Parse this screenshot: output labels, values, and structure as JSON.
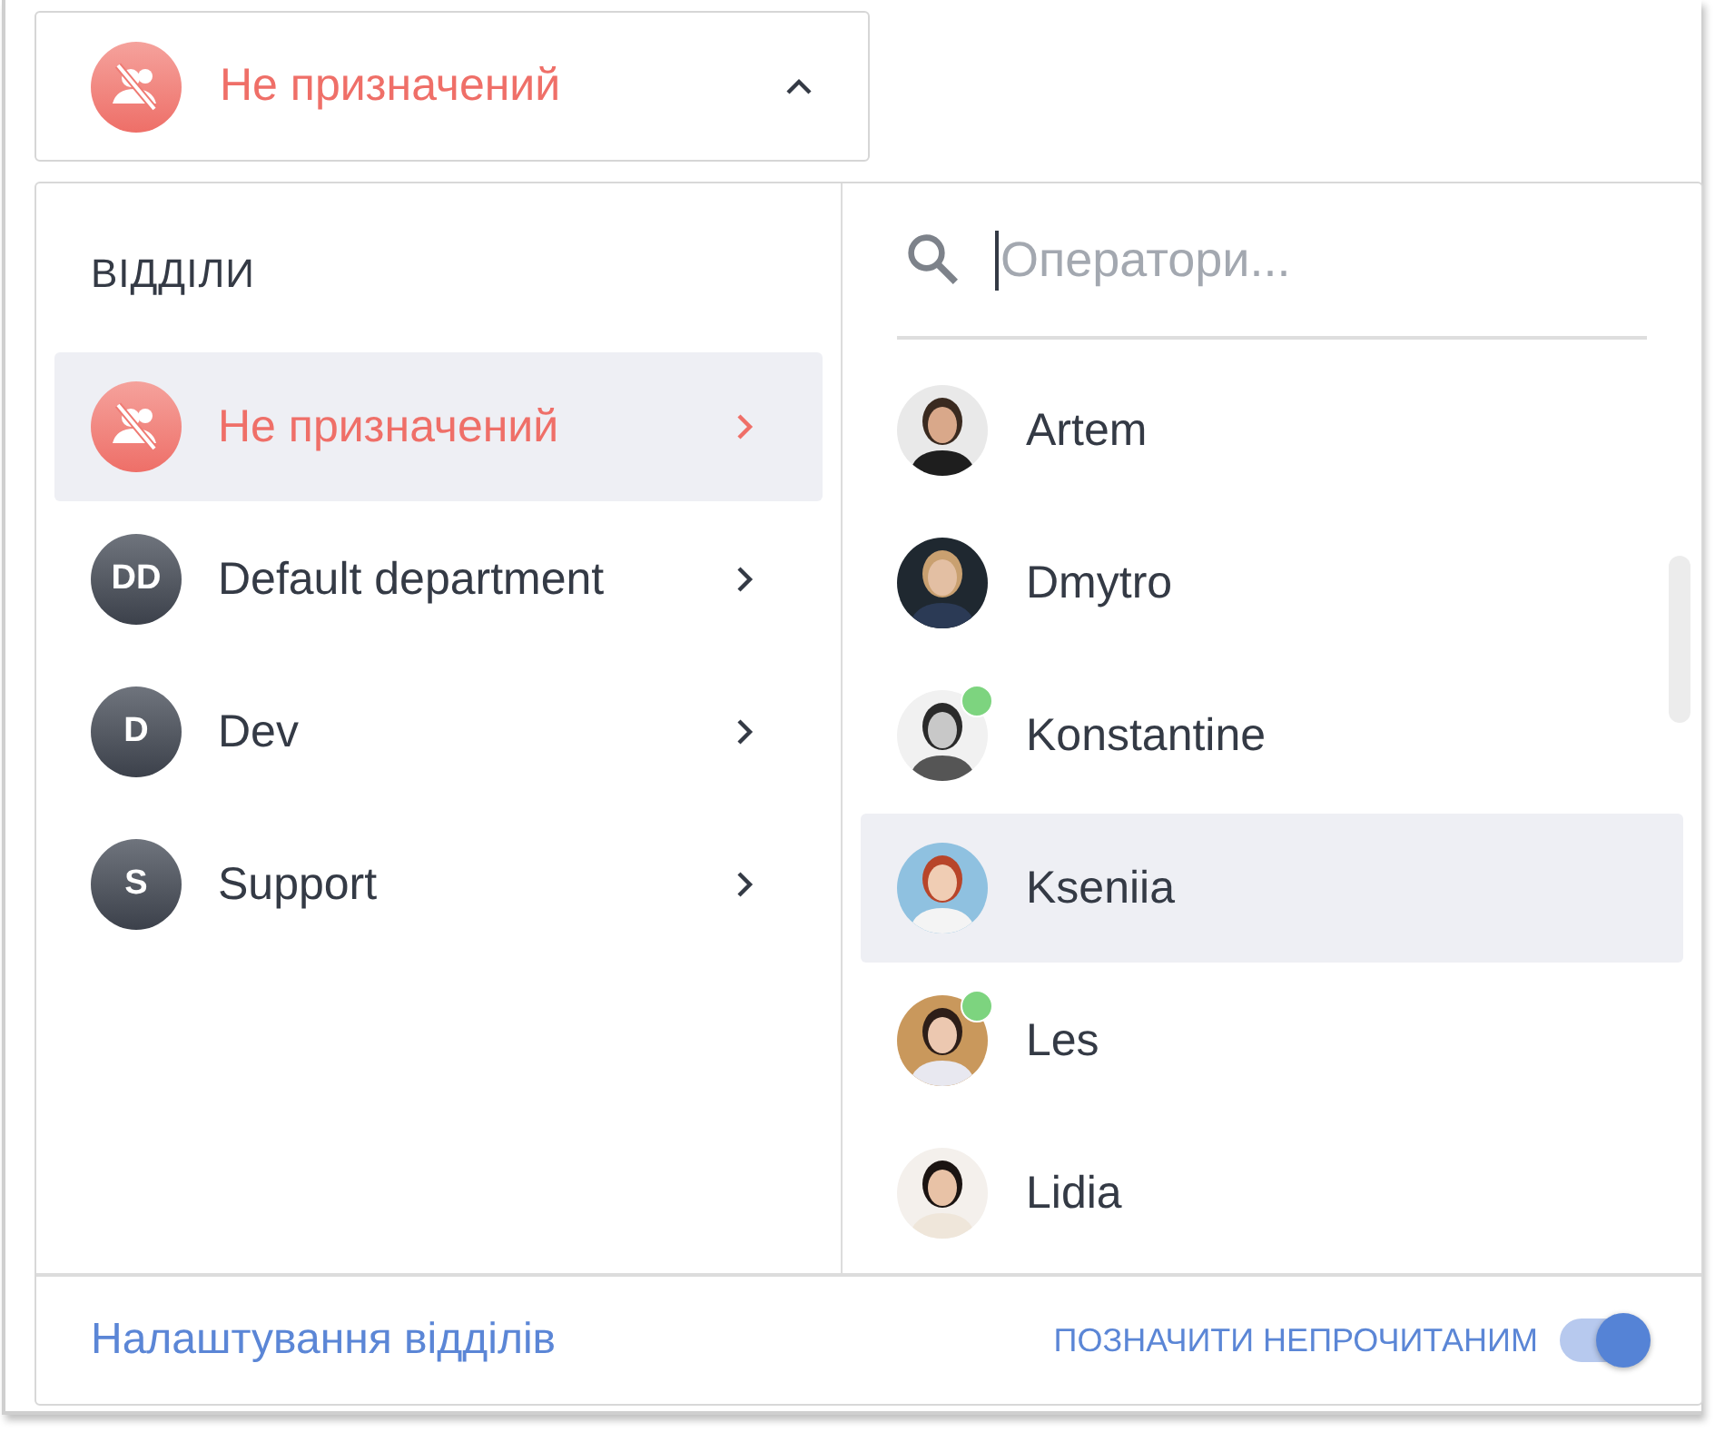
{
  "assignee_button": {
    "label": "Не призначений",
    "expanded": true
  },
  "departments": {
    "heading": "ВІДДІЛИ",
    "items": [
      {
        "kind": "unassigned",
        "name": "Не призначений",
        "selected": true
      },
      {
        "kind": "initials",
        "initials": "DD",
        "name": "Default department",
        "selected": false
      },
      {
        "kind": "initials",
        "initials": "D",
        "name": "Dev",
        "selected": false
      },
      {
        "kind": "initials",
        "initials": "S",
        "name": "Support",
        "selected": false
      }
    ]
  },
  "operators": {
    "search": {
      "placeholder": "Оператори..."
    },
    "items": [
      {
        "name": "Artem",
        "online": false,
        "selected": false
      },
      {
        "name": "Dmytro",
        "online": false,
        "selected": false
      },
      {
        "name": "Konstantine",
        "online": true,
        "selected": false
      },
      {
        "name": "Kseniia",
        "online": false,
        "selected": true
      },
      {
        "name": "Les",
        "online": true,
        "selected": false
      },
      {
        "name": "Lidia",
        "online": false,
        "selected": false
      }
    ]
  },
  "footer": {
    "settings_link": "Налаштування відділів",
    "mark_unread": {
      "label": "ПОЗНАЧИТИ НЕПРОЧИТАНИМ",
      "on": true
    }
  }
}
